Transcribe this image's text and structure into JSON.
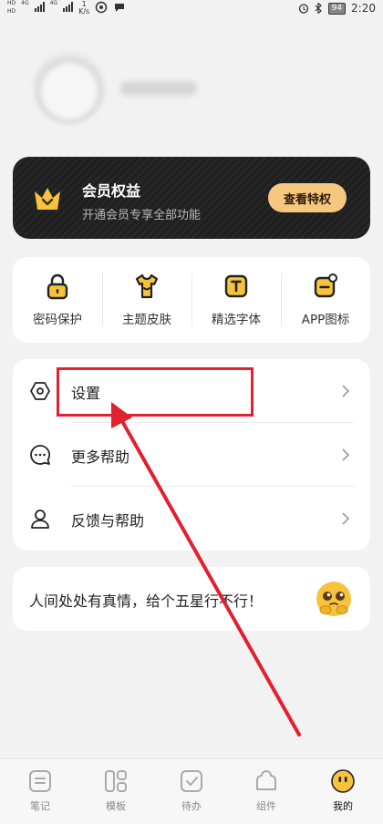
{
  "status_bar": {
    "net_a": "HD",
    "net_b": "HD",
    "net_4g": "4G",
    "net_4g_b": "4G",
    "speed_value": "1",
    "speed_unit": "K/s",
    "battery": "94",
    "time": "2:20"
  },
  "vip": {
    "title": "会员权益",
    "subtitle": "开通会员专享全部功能",
    "button": "查看特权"
  },
  "features": [
    {
      "label": "密码保护",
      "icon": "lock-icon"
    },
    {
      "label": "主题皮肤",
      "icon": "tshirt-icon"
    },
    {
      "label": "精选字体",
      "icon": "font-icon"
    },
    {
      "label": "APP图标",
      "icon": "app-icon"
    }
  ],
  "menu": [
    {
      "label": "设置",
      "icon": "hexagon-settings-icon"
    },
    {
      "label": "更多帮助",
      "icon": "chat-bubble-icon"
    },
    {
      "label": "反馈与帮助",
      "icon": "person-icon"
    }
  ],
  "rate": {
    "text": "人间处处有真情，给个五星行不行！",
    "icon": "pleading-emoji-icon"
  },
  "tabs": [
    {
      "label": "笔记",
      "icon": "note-icon"
    },
    {
      "label": "模板",
      "icon": "template-icon"
    },
    {
      "label": "待办",
      "icon": "todo-icon"
    },
    {
      "label": "组件",
      "icon": "widget-icon"
    },
    {
      "label": "我的",
      "icon": "me-face-icon"
    }
  ],
  "colors": {
    "accent": "#f7c33d",
    "vip_button": "#f6c77f",
    "annotation_red": "#e0212f",
    "background": "#f2f2f2"
  }
}
